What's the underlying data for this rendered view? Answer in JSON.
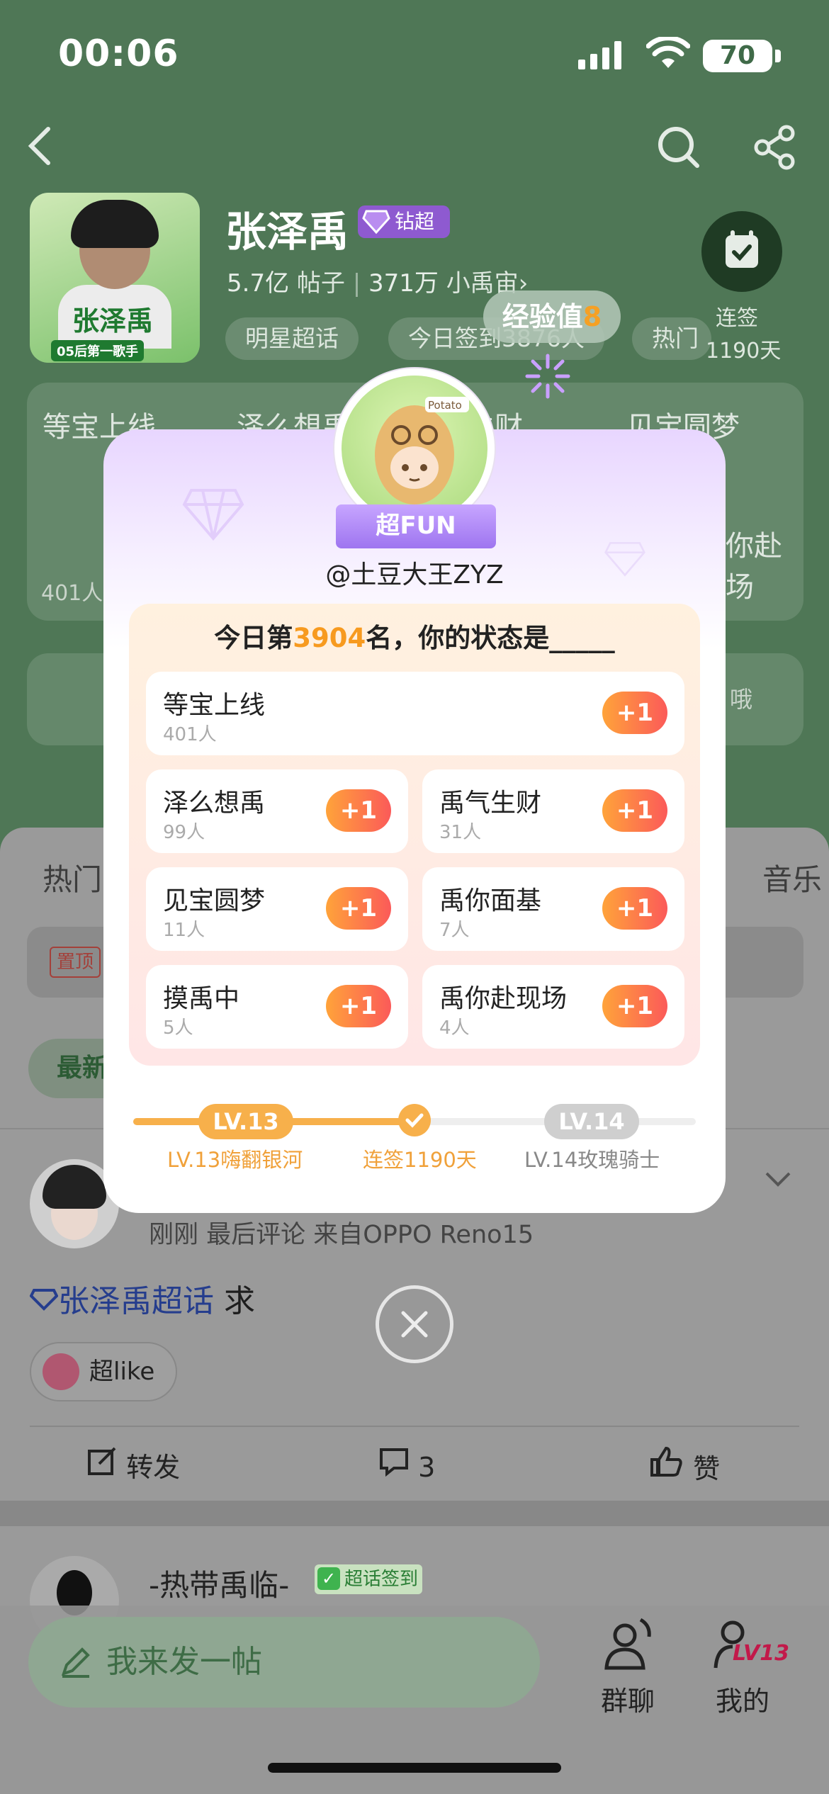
{
  "status_bar": {
    "time": "00:06",
    "battery": "70"
  },
  "header": {
    "title": "张泽禹",
    "badge": "钻超",
    "avatar_text_main": "张泽禹",
    "avatar_text_sub": "05后第一歌手",
    "stats": {
      "posts_value": "5.7亿",
      "posts_label": "帖子",
      "fans_value": "371万",
      "fans_label": "小禹宙"
    },
    "tags": [
      "明星超话",
      "今日签到3876人",
      "热门"
    ],
    "signin_label": "连签",
    "signin_days": "1190天"
  },
  "background_board": {
    "items": [
      "等宝上线",
      "泽么想禹",
      "禹气生财",
      "见宝圆梦",
      "禹你赴现场"
    ],
    "count": "401人",
    "hint": "哦"
  },
  "tabs": {
    "left": "热门",
    "right": "音乐"
  },
  "pinned_label": "置顶",
  "newest_label": "最新",
  "post": {
    "meta": "刚刚 最后评论  来自OPPO Reno15",
    "topic_link": "张泽禹超话",
    "body": " 求",
    "chip_label": "超like",
    "actions": {
      "repost": "转发",
      "comment_count": "3",
      "like": "赞"
    }
  },
  "post2": {
    "user": "-热带禹临-",
    "badge": "超话签到"
  },
  "bottom_bar": {
    "compose_placeholder": "我来发一帖",
    "nav": [
      {
        "label": "群聊",
        "icon": "group-chat-icon"
      },
      {
        "label": "我的",
        "icon": "profile-icon",
        "level": "LV13"
      }
    ]
  },
  "modal": {
    "xp_label": "经验值",
    "xp_value": "8",
    "avatar_caption": "Potato",
    "ribbon": "超FUN",
    "handle": "@土豆大王ZYZ",
    "rank_prefix": "今日第",
    "rank_value": "3904",
    "rank_suffix": "名，你的状态是_____",
    "states": [
      {
        "name": "等宝上线",
        "count": "401人",
        "action": "+1"
      },
      {
        "name": "泽么想禹",
        "count": "99人",
        "action": "+1"
      },
      {
        "name": "禹气生财",
        "count": "31人",
        "action": "+1"
      },
      {
        "name": "见宝圆梦",
        "count": "11人",
        "action": "+1"
      },
      {
        "name": "禹你面基",
        "count": "7人",
        "action": "+1"
      },
      {
        "name": "摸禹中",
        "count": "5人",
        "action": "+1"
      },
      {
        "name": "禹你赴现场",
        "count": "4人",
        "action": "+1"
      }
    ],
    "progress": {
      "current_level": "LV.13",
      "next_level": "LV.14",
      "current_label": "LV.13嗨翻银河",
      "streak_label": "连签1190天",
      "next_label": "LV.14玫瑰骑士",
      "fraction": 0.5
    }
  },
  "colors": {
    "accent_orange": "#f79a1f",
    "plus_gradient_start": "#ffa33a",
    "plus_gradient_end": "#fb5a59",
    "badge_purple": "#8e5ad0"
  }
}
